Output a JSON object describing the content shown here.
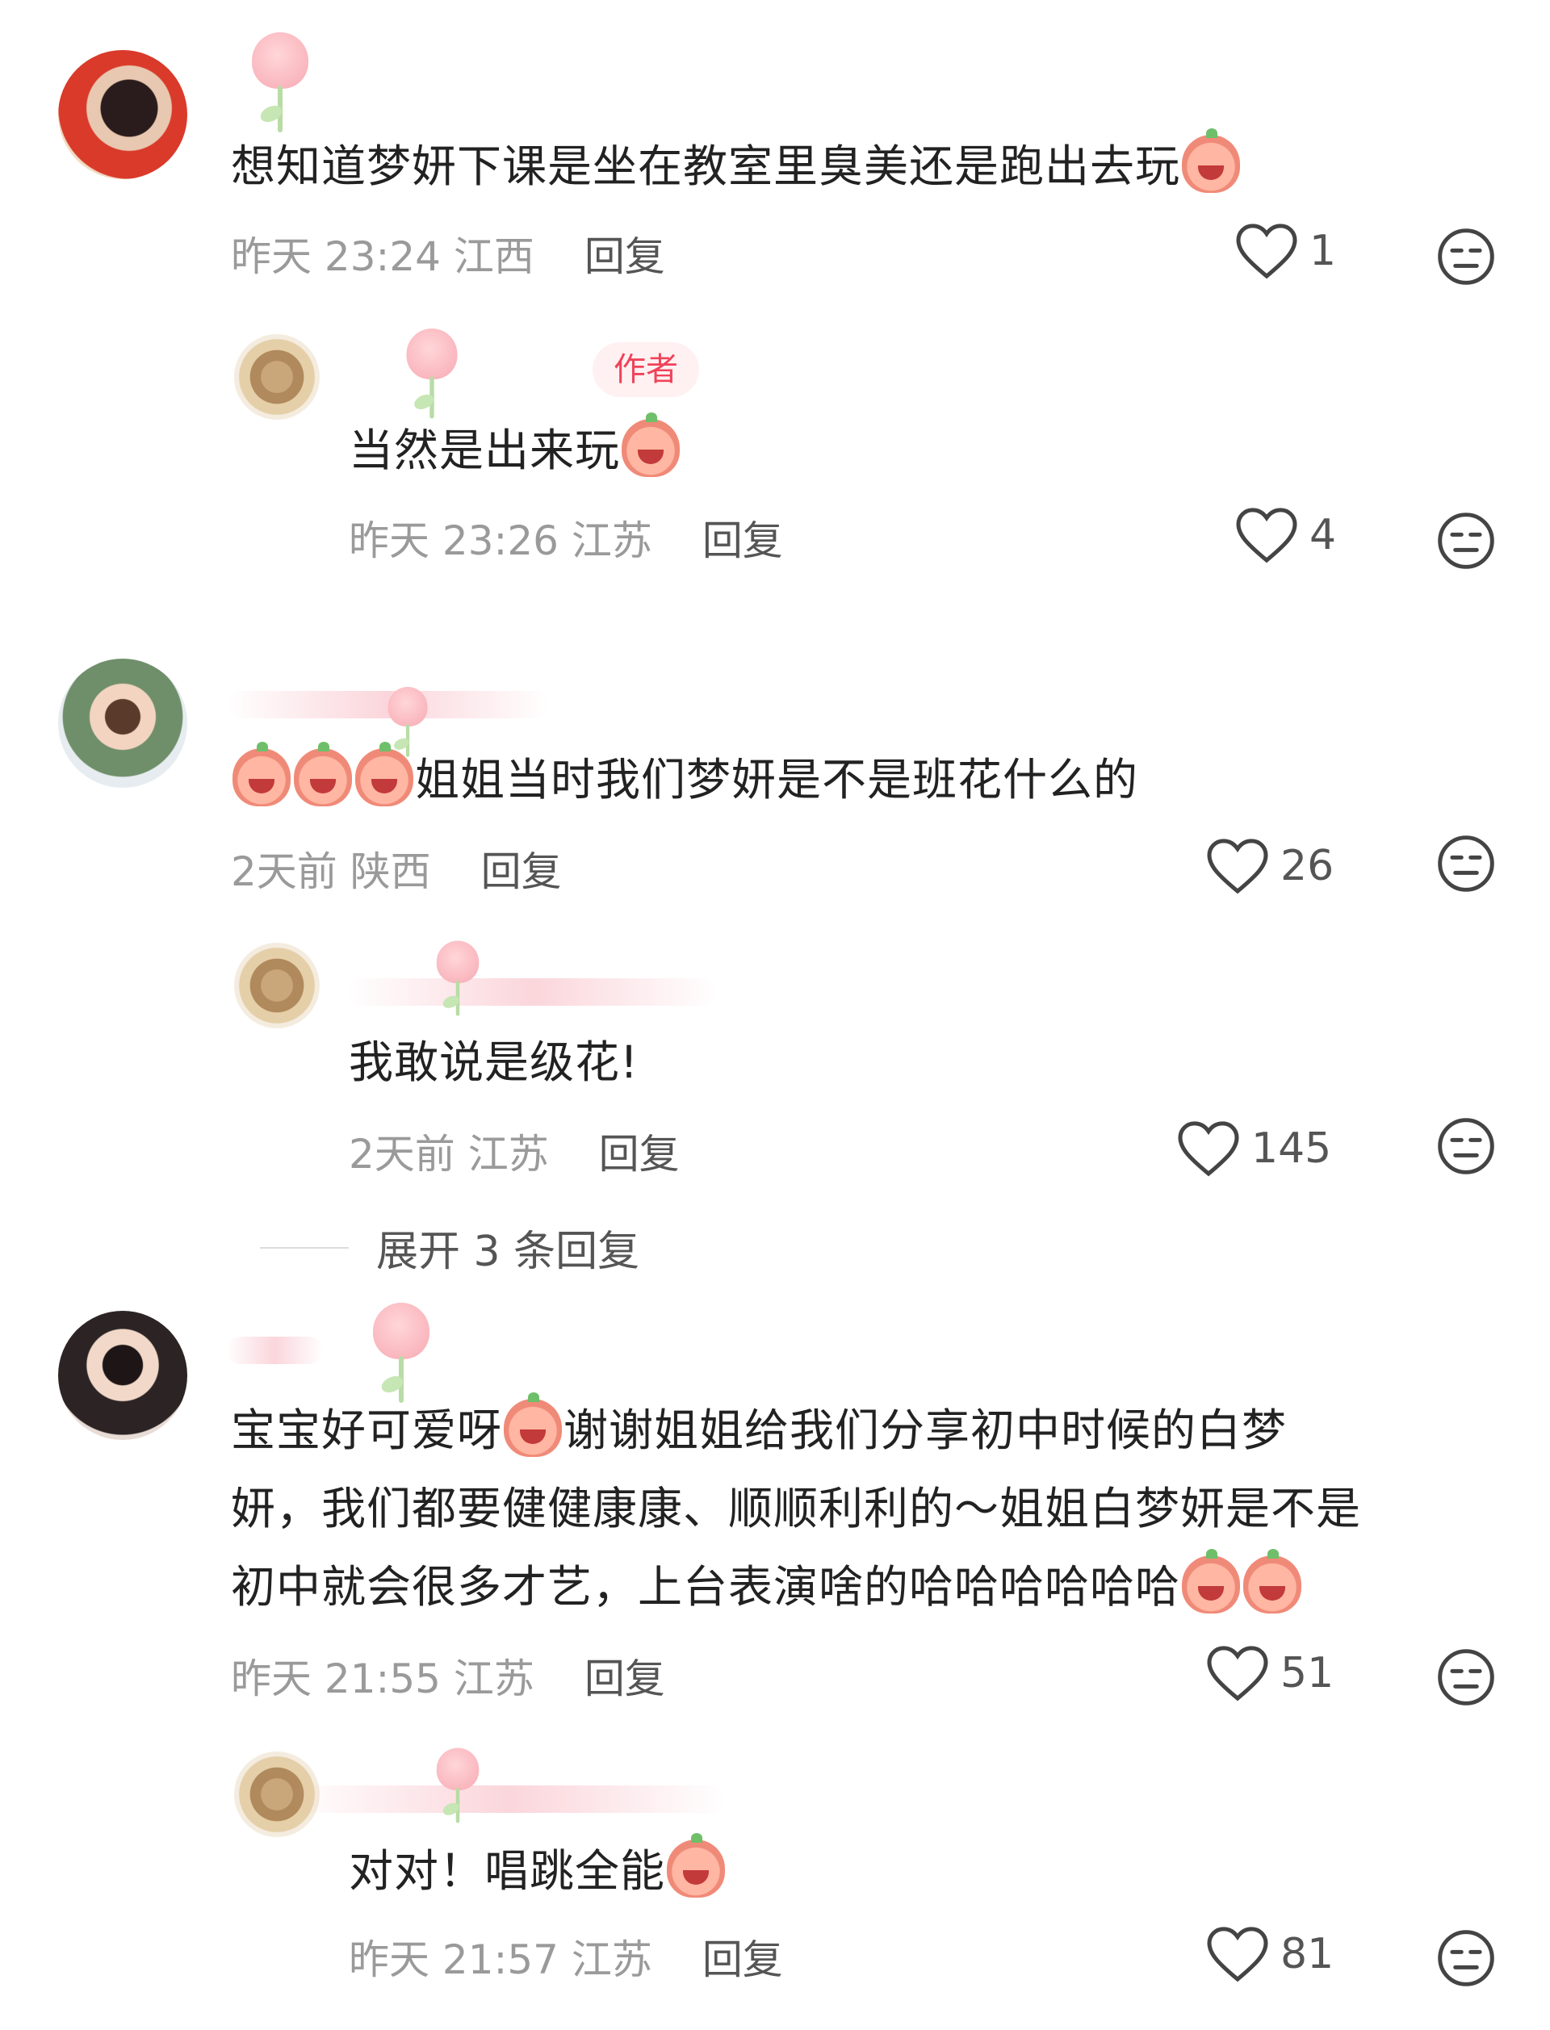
{
  "comments": [
    {
      "text": "想知道梦妍下课是坐在教室里臭美还是跑出去玩",
      "time": "昨天 23:24",
      "location": "江西",
      "reply_label": "回复",
      "likes": "1",
      "reply": {
        "author_badge": "作者",
        "text": "当然是出来玩",
        "time": "昨天 23:26",
        "location": "江苏",
        "reply_label": "回复",
        "likes": "4"
      }
    },
    {
      "text": "姐姐当时我们梦妍是不是班花什么的",
      "time": "2天前",
      "location": "陕西",
      "reply_label": "回复",
      "likes": "26",
      "reply": {
        "text": "我敢说是级花!",
        "time": "2天前",
        "location": "江苏",
        "reply_label": "回复",
        "likes": "145"
      },
      "expand_label": "展开 3 条回复"
    },
    {
      "text_line1a": "宝宝好可爱呀",
      "text_line1b": "谢谢姐姐给我们分享初中时候的白梦",
      "text_line2": "妍，我们都要健健康康、顺顺利利的～姐姐白梦妍是不是",
      "text_line3": "初中就会很多才艺，上台表演啥的哈哈哈哈哈哈",
      "time": "昨天 21:55",
      "location": "江苏",
      "reply_label": "回复",
      "likes": "51",
      "reply": {
        "text": "对对！唱跳全能",
        "time": "昨天 21:57",
        "location": "江苏",
        "reply_label": "回复",
        "likes": "81"
      }
    }
  ],
  "icons": {
    "like": "heart-outline-icon",
    "dislike": "neutral-face-icon",
    "emoji": "peach-face-sticker"
  },
  "colors": {
    "author_badge_text": "#f0435a",
    "author_badge_bg": "#fff1f2",
    "meta_text": "#9a9a9a",
    "action_text": "#555555"
  }
}
